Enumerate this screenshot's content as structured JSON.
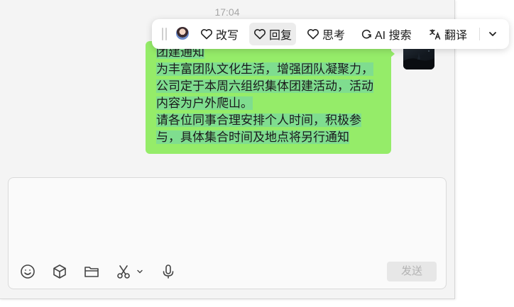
{
  "chat": {
    "timestamp": "17:04",
    "message_lines": [
      "团建通知",
      "为丰富团队文化生活，增强团队凝聚力，",
      "公司定于本周六组织集体团建活动，活动",
      "内容为户外爬山。",
      "请各位同事合理安排个人时间，积极参",
      "与，具体集合时间及地点将另行通知"
    ],
    "bubble_color": "#95ec69",
    "selection_color": "#7fdd8f"
  },
  "toolbar": {
    "rewrite_label": "改写",
    "reply_label": "回复",
    "think_label": "思考",
    "ai_search_label": "AI 搜索",
    "translate_label": "翻译"
  },
  "input": {
    "send_label": "发送",
    "icons": [
      "emoji-icon",
      "cube-icon",
      "folder-icon",
      "scissors-icon",
      "chevron-down-icon",
      "microphone-icon"
    ]
  }
}
